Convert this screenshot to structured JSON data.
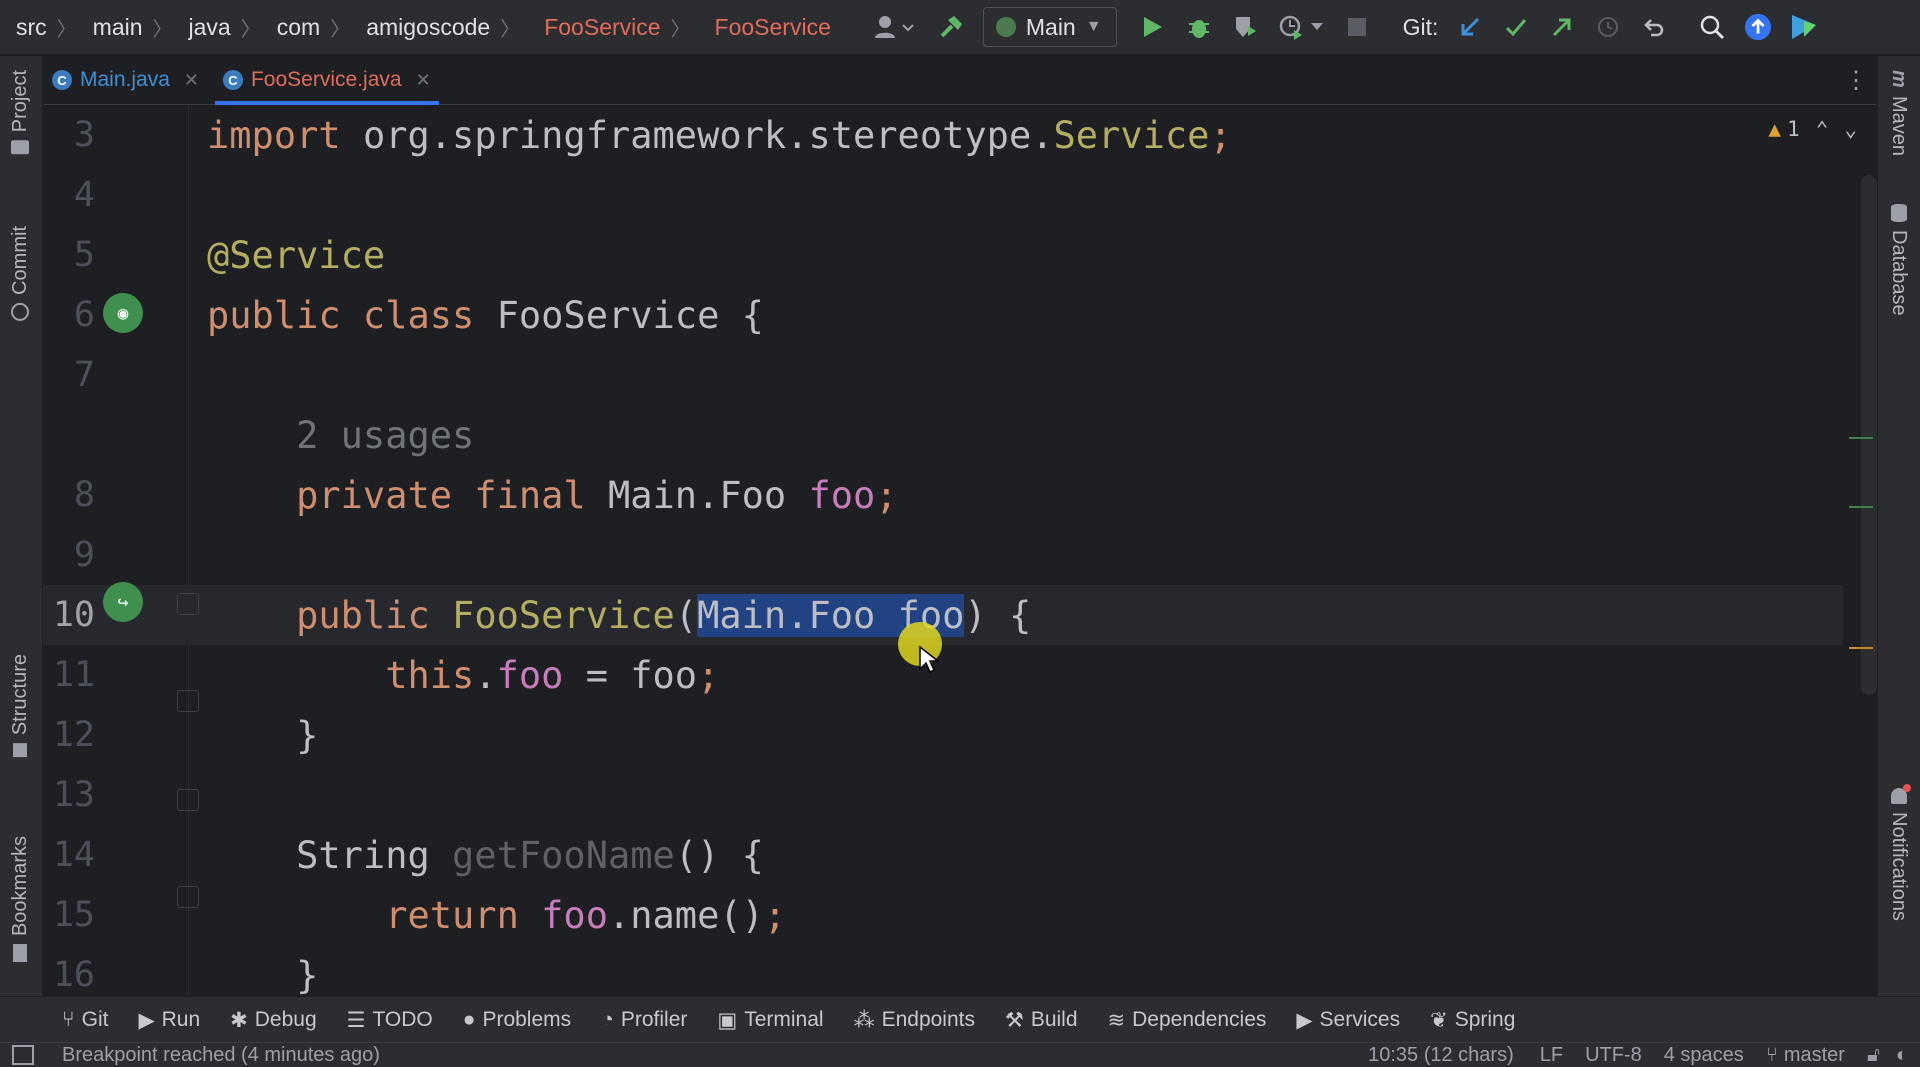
{
  "toolbar": {
    "breadcrumbs": [
      "src",
      "main",
      "java",
      "com",
      "amigoscode"
    ],
    "highlight_crumbs": [
      "FooService",
      "FooService"
    ],
    "run_config": "Main",
    "git_label": "Git:"
  },
  "tabs": [
    {
      "label": "Main.java",
      "active": false
    },
    {
      "label": "FooService.java",
      "active": true
    }
  ],
  "left_tools": [
    "Project",
    "Commit",
    "Structure",
    "Bookmarks"
  ],
  "right_tools": [
    "Maven",
    "Database",
    "Notifications"
  ],
  "editor": {
    "warning_count": "1",
    "lines": [
      {
        "num": "3",
        "tokens": [
          [
            "kw",
            "import "
          ],
          [
            "",
            "org.springframework.stereotype."
          ],
          [
            "typeY",
            "Service"
          ],
          [
            "kw",
            ";"
          ]
        ]
      },
      {
        "num": "4",
        "tokens": []
      },
      {
        "num": "5",
        "tokens": [
          [
            "ann",
            "@Service"
          ]
        ]
      },
      {
        "num": "6",
        "tokens": [
          [
            "kw",
            "public class "
          ],
          [
            "",
            "FooService {"
          ]
        ]
      },
      {
        "num": "7",
        "tokens": []
      },
      {
        "num": "",
        "tokens": [
          [
            "hint",
            "    2 usages"
          ]
        ]
      },
      {
        "num": "8",
        "tokens": [
          [
            "kw",
            "    private final "
          ],
          [
            "",
            "Main.Foo "
          ],
          [
            "fld",
            "foo"
          ],
          [
            "kw",
            ";"
          ]
        ]
      },
      {
        "num": "9",
        "tokens": []
      },
      {
        "num": "10",
        "tokens": [
          [
            "kw",
            "    public "
          ],
          [
            "typeY",
            "FooService"
          ],
          [
            "",
            "("
          ],
          [
            "sel",
            "Main.Foo foo"
          ],
          [
            "",
            ") {"
          ]
        ]
      },
      {
        "num": "11",
        "tokens": [
          [
            "kw",
            "        this"
          ],
          [
            "",
            "."
          ],
          [
            "fld",
            "foo"
          ],
          [
            "",
            " = foo"
          ],
          [
            "kw",
            ";"
          ]
        ]
      },
      {
        "num": "12",
        "tokens": [
          [
            "",
            "    }"
          ]
        ]
      },
      {
        "num": "13",
        "tokens": []
      },
      {
        "num": "14",
        "tokens": [
          [
            "",
            "    String "
          ],
          [
            "mfn",
            "getFooName"
          ],
          [
            "",
            "() {"
          ]
        ]
      },
      {
        "num": "15",
        "tokens": [
          [
            "kw",
            "        return "
          ],
          [
            "fld",
            "foo"
          ],
          [
            "",
            ".name()"
          ],
          [
            "kw",
            ";"
          ]
        ]
      },
      {
        "num": "16",
        "tokens": [
          [
            "",
            "    }"
          ]
        ]
      }
    ]
  },
  "bottom_tools": [
    "Git",
    "Run",
    "Debug",
    "TODO",
    "Problems",
    "Profiler",
    "Terminal",
    "Endpoints",
    "Build",
    "Dependencies",
    "Services",
    "Spring"
  ],
  "status": {
    "message": "Breakpoint reached (4 minutes ago)",
    "position": "10:35 (12 chars)",
    "line_sep": "LF",
    "encoding": "UTF-8",
    "indent": "4 spaces",
    "branch": "master"
  }
}
